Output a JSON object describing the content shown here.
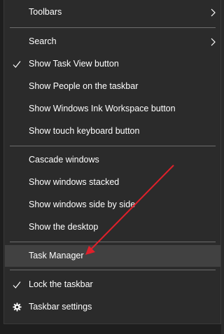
{
  "menu": {
    "toolbars": "Toolbars",
    "search": "Search",
    "show_task_view": "Show Task View button",
    "show_people": "Show People on the taskbar",
    "show_ink": "Show Windows Ink Workspace button",
    "show_touch_keyboard": "Show touch keyboard button",
    "cascade": "Cascade windows",
    "stacked": "Show windows stacked",
    "side_by_side": "Show windows side by side",
    "show_desktop": "Show the desktop",
    "task_manager": "Task Manager",
    "lock_taskbar": "Lock the taskbar",
    "taskbar_settings": "Taskbar settings"
  },
  "icons": {
    "check": "checkmark-icon",
    "gear": "gear-icon",
    "submenu": "chevron-right-icon"
  },
  "colors": {
    "menu_bg": "#2b2b2b",
    "hover_bg": "#414141",
    "text": "#ffffff",
    "separator": "#6d6d6d",
    "annotation_arrow": "#e0202a"
  }
}
